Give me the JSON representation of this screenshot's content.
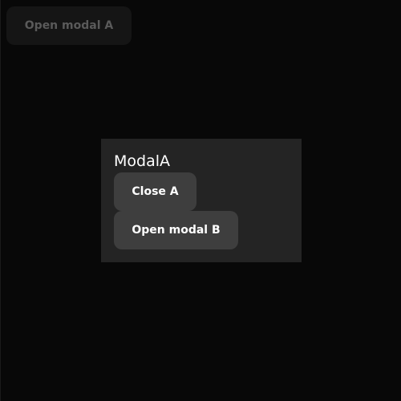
{
  "background": {
    "open_modal_a_label": "Open modal A"
  },
  "modal_a": {
    "title": "ModalA",
    "close_label": "Close A",
    "open_b_label": "Open modal B"
  },
  "colors": {
    "page_background": "#080808",
    "modal_background": "#242424",
    "modal_button_background": "#3e3e3e",
    "disabled_button_background": "#151515",
    "disabled_button_text": "#5a5a5a",
    "text_primary": "#ffffff"
  }
}
